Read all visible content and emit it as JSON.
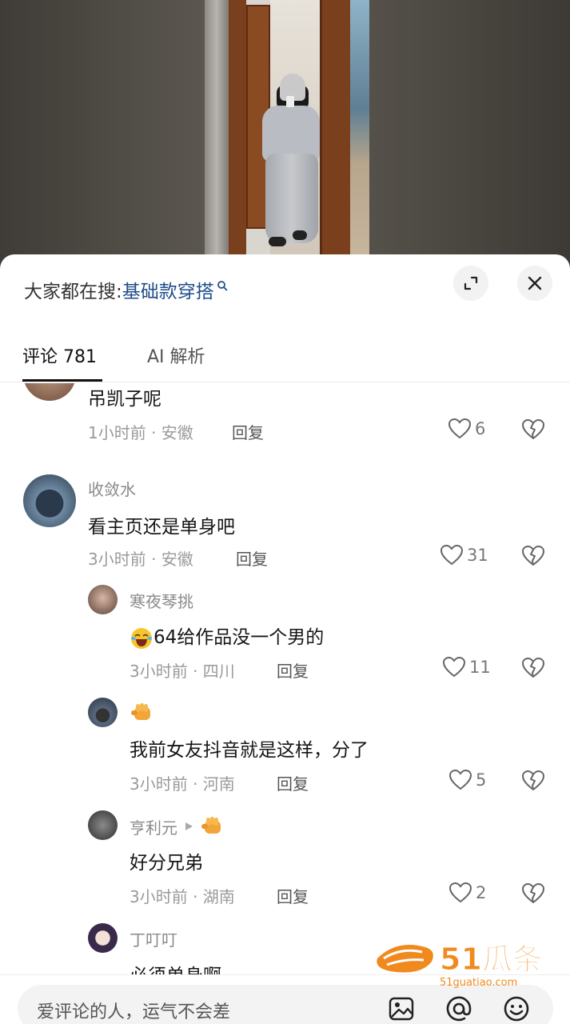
{
  "video": {
    "alt": "video frame"
  },
  "search": {
    "prefix": "大家都在搜:",
    "term": "基础款穿搭"
  },
  "tabs": {
    "comments": "评论 781",
    "ai": "AI 解析"
  },
  "comments": [
    {
      "text": "吊凯子呢",
      "meta": "1小时前 · 安徽",
      "reply": "回复",
      "likes": "6"
    },
    {
      "name": "收敛水",
      "text": "看主页还是单身吧",
      "meta": "3小时前 · 安徽",
      "reply": "回复",
      "likes": "31"
    },
    {
      "name": "寒夜琴挑",
      "text": "64给作品没一个男的",
      "meta": "3小时前 · 四川",
      "reply": "回复",
      "likes": "11"
    },
    {
      "text": "我前女友抖音就是这样，分了",
      "meta": "3小时前 · 河南",
      "reply": "回复",
      "likes": "5"
    },
    {
      "name": "亨利元",
      "text": "好分兄弟",
      "meta": "3小时前 · 湖南",
      "reply": "回复",
      "likes": "2"
    },
    {
      "name": "丁叮叮",
      "text": "必须单身啊"
    }
  ],
  "input": {
    "placeholder": "爱评论的人，运气不会差"
  },
  "watermark": {
    "brand": "51瓜条",
    "url": "51guatiao.com"
  },
  "colors": {
    "accent": "#1f4d8a",
    "watermark": "#f08a1e"
  }
}
